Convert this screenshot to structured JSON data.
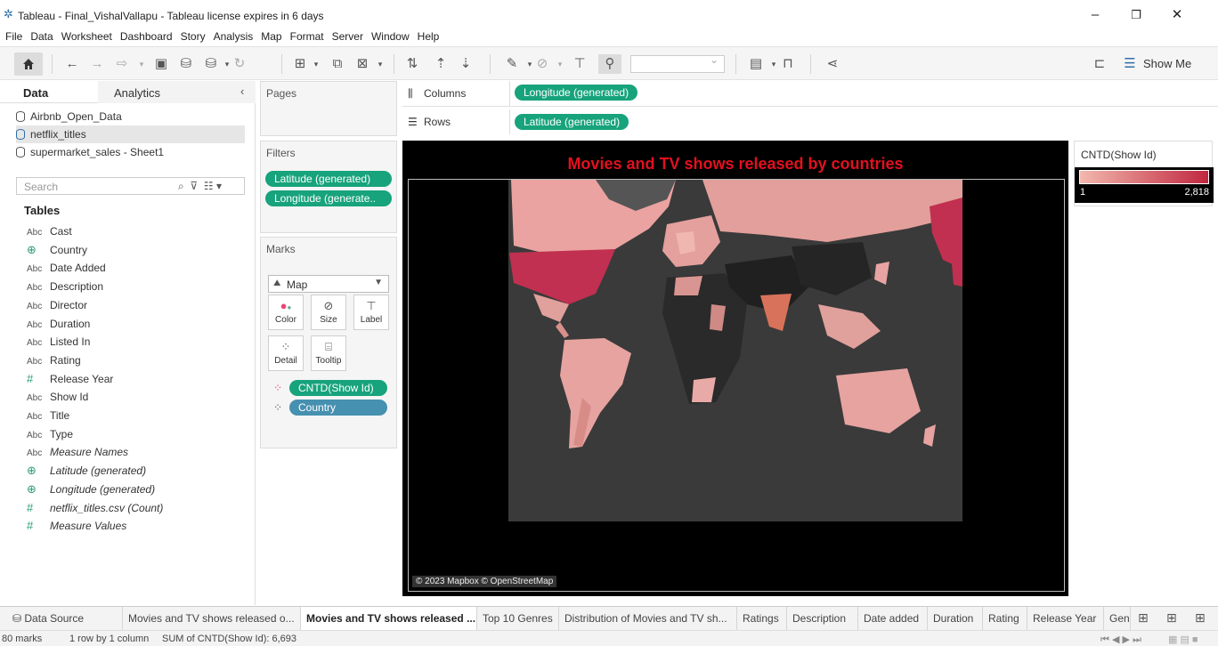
{
  "window": {
    "title": "Tableau - Final_VishalVallapu - Tableau license expires in 6 days",
    "minimize": "–",
    "restore": "❐",
    "close": "✕"
  },
  "menu": [
    "File",
    "Data",
    "Worksheet",
    "Dashboard",
    "Story",
    "Analysis",
    "Map",
    "Format",
    "Server",
    "Window",
    "Help"
  ],
  "toolbar": {
    "show_me_label": "Show Me",
    "icons": [
      "home-icon",
      "back-icon",
      "forward-icon",
      "redo-icon",
      "save-icon",
      "add-datasource-icon",
      "datasource-icon",
      "refresh-icon",
      "new-worksheet-icon",
      "duplicate-icon",
      "clear-sheet-icon",
      "swap-icon",
      "sort-asc-icon",
      "sort-desc-icon",
      "highlight-icon",
      "group-icon",
      "label-icon",
      "fix-axes-icon",
      "fit-icon",
      "presentation-icon",
      "share-icon",
      "tooltip-icon",
      "show-me-icon"
    ]
  },
  "data_pane": {
    "tab_data": "Data",
    "tab_analytics": "Analytics",
    "collapse": "‹",
    "datasources": [
      {
        "name": "Airbnb_Open_Data",
        "selected": false
      },
      {
        "name": "netflix_titles",
        "selected": true
      },
      {
        "name": "supermarket_sales - Sheet1",
        "selected": false
      }
    ],
    "search_placeholder": "Search",
    "tables_heading": "Tables",
    "fields": [
      {
        "type": "Abc",
        "name": "Cast",
        "italic": false
      },
      {
        "type": "geo",
        "name": "Country",
        "italic": false
      },
      {
        "type": "Abc",
        "name": "Date Added",
        "italic": false
      },
      {
        "type": "Abc",
        "name": "Description",
        "italic": false
      },
      {
        "type": "Abc",
        "name": "Director",
        "italic": false
      },
      {
        "type": "Abc",
        "name": "Duration",
        "italic": false
      },
      {
        "type": "Abc",
        "name": "Listed In",
        "italic": false
      },
      {
        "type": "Abc",
        "name": "Rating",
        "italic": false
      },
      {
        "type": "#",
        "name": "Release Year",
        "italic": false
      },
      {
        "type": "Abc",
        "name": "Show Id",
        "italic": false
      },
      {
        "type": "Abc",
        "name": "Title",
        "italic": false
      },
      {
        "type": "Abc",
        "name": "Type",
        "italic": false
      },
      {
        "type": "Abc",
        "name": "Measure Names",
        "italic": true
      },
      {
        "type": "geo",
        "name": "Latitude (generated)",
        "italic": true
      },
      {
        "type": "geo",
        "name": "Longitude (generated)",
        "italic": true
      },
      {
        "type": "#",
        "name": "netflix_titles.csv (Count)",
        "italic": true
      },
      {
        "type": "#",
        "name": "Measure Values",
        "italic": true
      }
    ]
  },
  "pages": {
    "title": "Pages"
  },
  "filters": {
    "title": "Filters",
    "pills": [
      "Latitude (generated)",
      "Longitude (generate.."
    ]
  },
  "marks": {
    "title": "Marks",
    "type": "Map",
    "cards": [
      "Color",
      "Size",
      "Label",
      "Detail",
      "Tooltip"
    ],
    "pills": [
      {
        "label": "CNTD(Show Id)",
        "color": "green"
      },
      {
        "label": "Country",
        "color": "blue"
      }
    ]
  },
  "shelves": {
    "columns_label": "Columns",
    "columns_pill": "Longitude (generated)",
    "rows_label": "Rows",
    "rows_pill": "Latitude (generated)"
  },
  "view": {
    "title": "Movies and TV shows released by countries",
    "credit": "© 2023 Mapbox © OpenStreetMap"
  },
  "legend": {
    "title": "CNTD(Show Id)",
    "min": "1",
    "max": "2,818",
    "color_low": "#f2b8ad",
    "color_high": "#c1273f"
  },
  "sheet_tabs": [
    {
      "label": "Data Source",
      "active": false,
      "icon": "datasource-icon"
    },
    {
      "label": "Movies and TV shows released o...",
      "active": false
    },
    {
      "label": "Movies and TV shows released ...",
      "active": true
    },
    {
      "label": "Top 10 Genres",
      "active": false
    },
    {
      "label": "Distribution of Movies and TV sh...",
      "active": false
    },
    {
      "label": "Ratings",
      "active": false
    },
    {
      "label": "Description",
      "active": false
    },
    {
      "label": "Date added",
      "active": false
    },
    {
      "label": "Duration",
      "active": false
    },
    {
      "label": "Rating",
      "active": false
    },
    {
      "label": "Release Year",
      "active": false
    },
    {
      "label": "Gen",
      "active": false
    }
  ],
  "status": {
    "marks": "80 marks",
    "dims": "1 row by 1 column",
    "sum": "SUM of CNTD(Show Id): 6,693"
  },
  "colors": {
    "accent_green": "#17a37c",
    "pill_blue": "#4690b0",
    "title_red": "#e3101f"
  }
}
